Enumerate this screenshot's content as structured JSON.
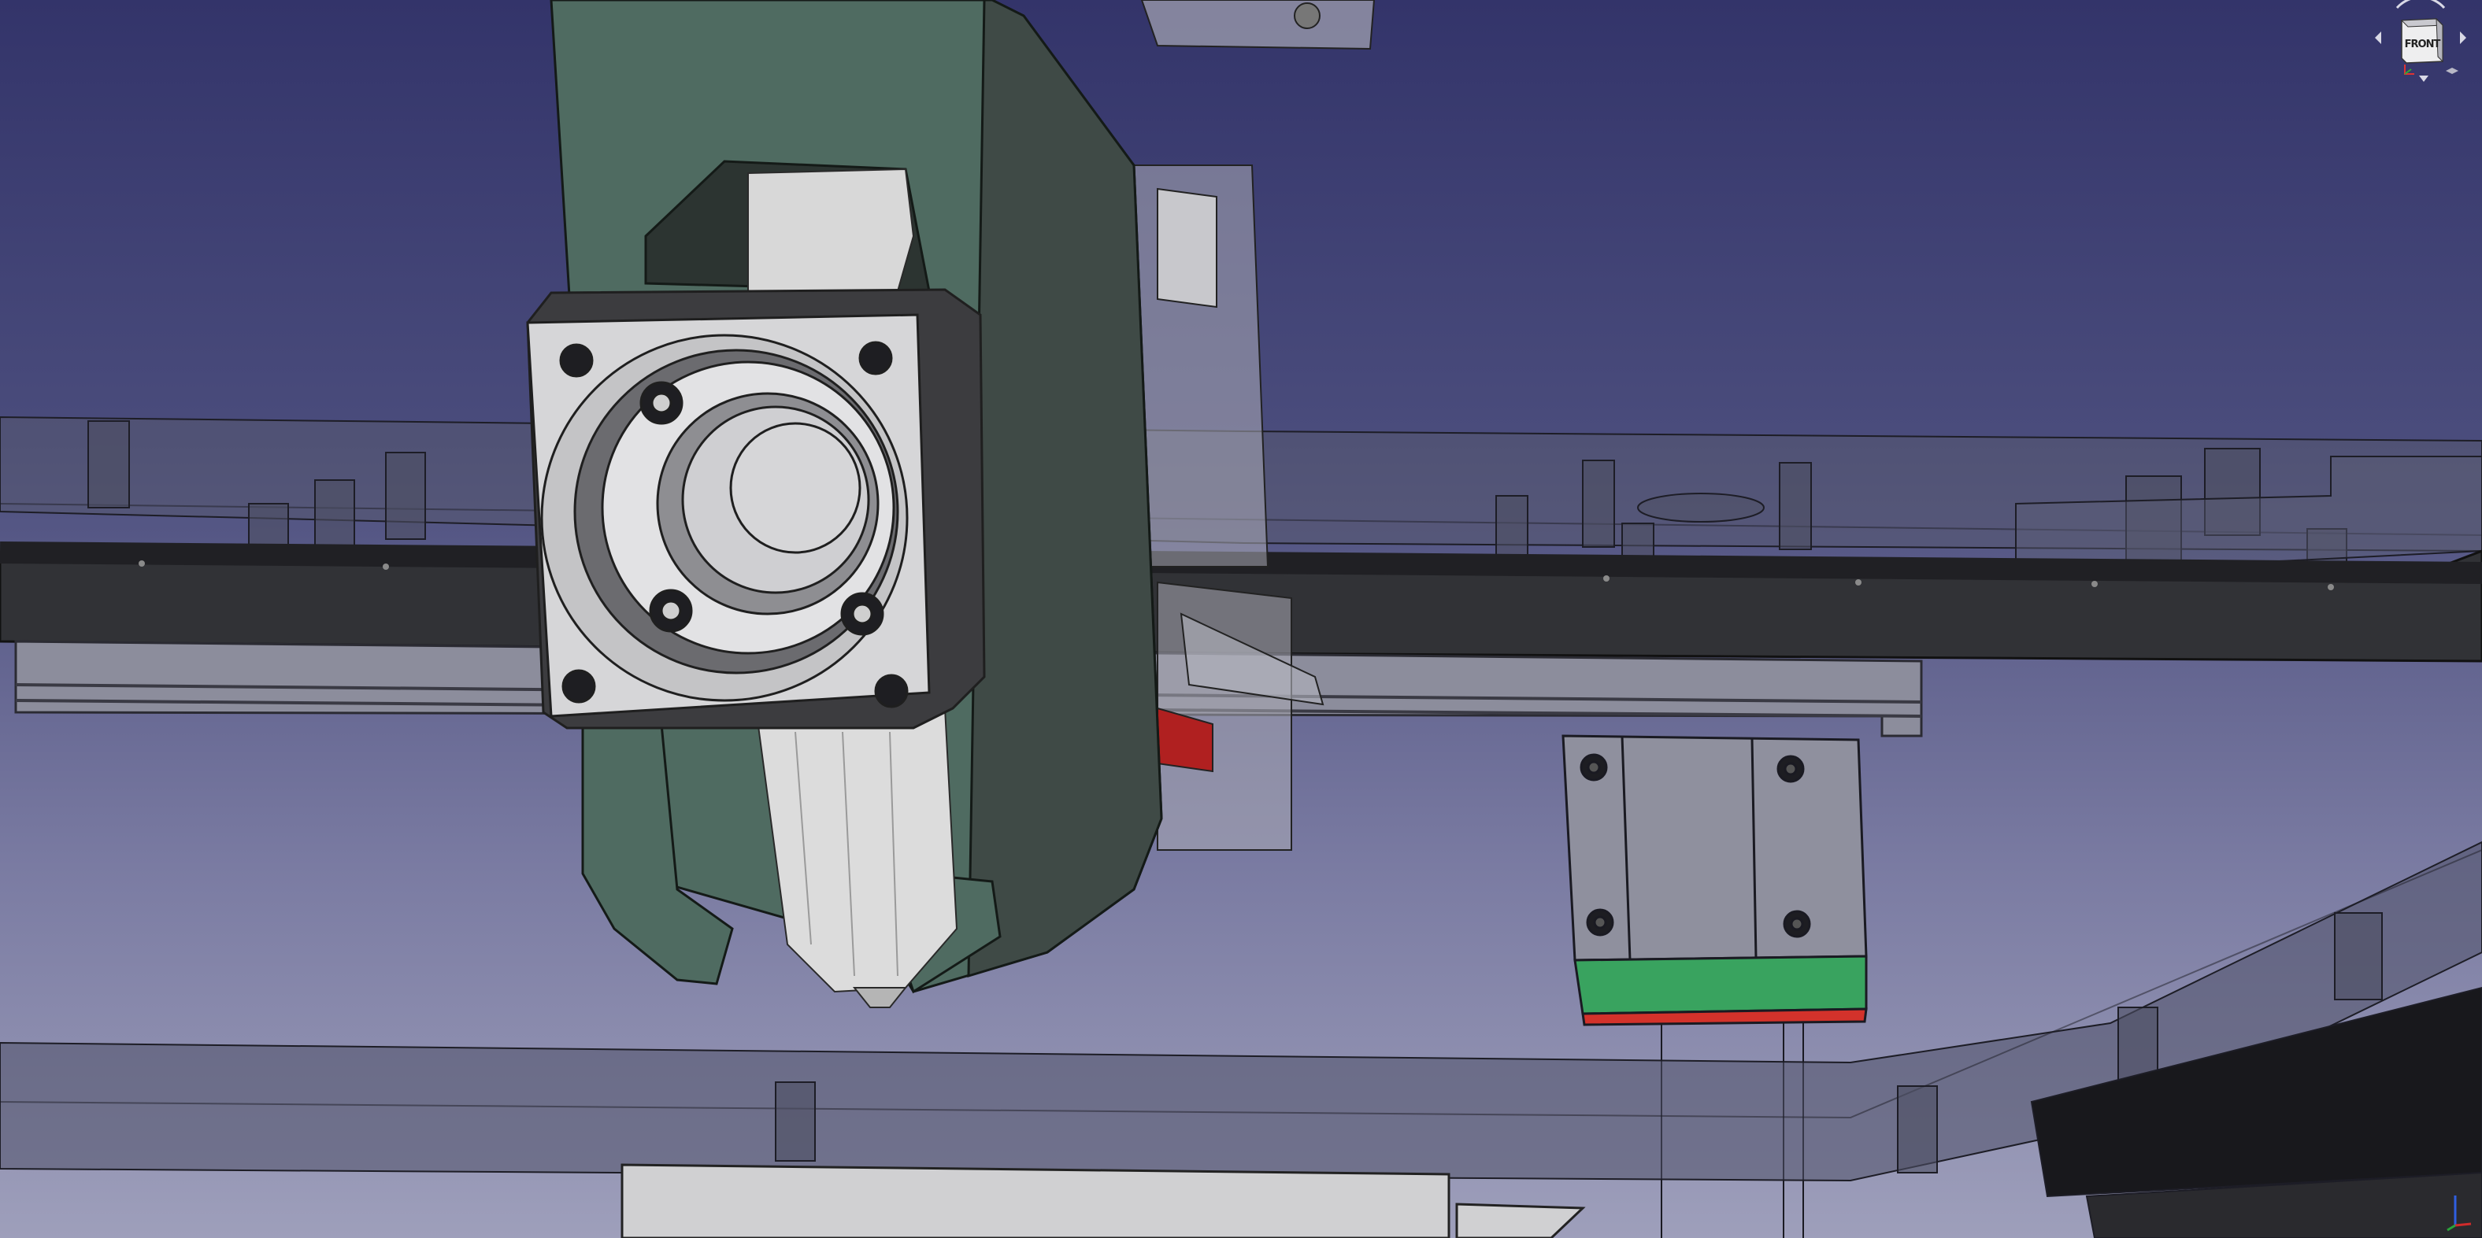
{
  "app": {
    "view": "3d-viewport"
  },
  "navcube": {
    "face_label": "FRONT"
  },
  "colors": {
    "bg_top": "#33346a",
    "bg_bottom": "#9e9fbb",
    "body_green": "#4f6b61",
    "rail_carriage_green": "#39a35f",
    "rail_carriage_red": "#d3322b",
    "part_white": "#d8d8d8",
    "frame_dark": "#2b2c30",
    "accent_red": "#b02020"
  },
  "icons": {
    "navcube": "view-cube-icon",
    "rotate_left": "rotate-left-icon",
    "rotate_right": "rotate-right-icon",
    "axis": "axis-triad-icon"
  }
}
